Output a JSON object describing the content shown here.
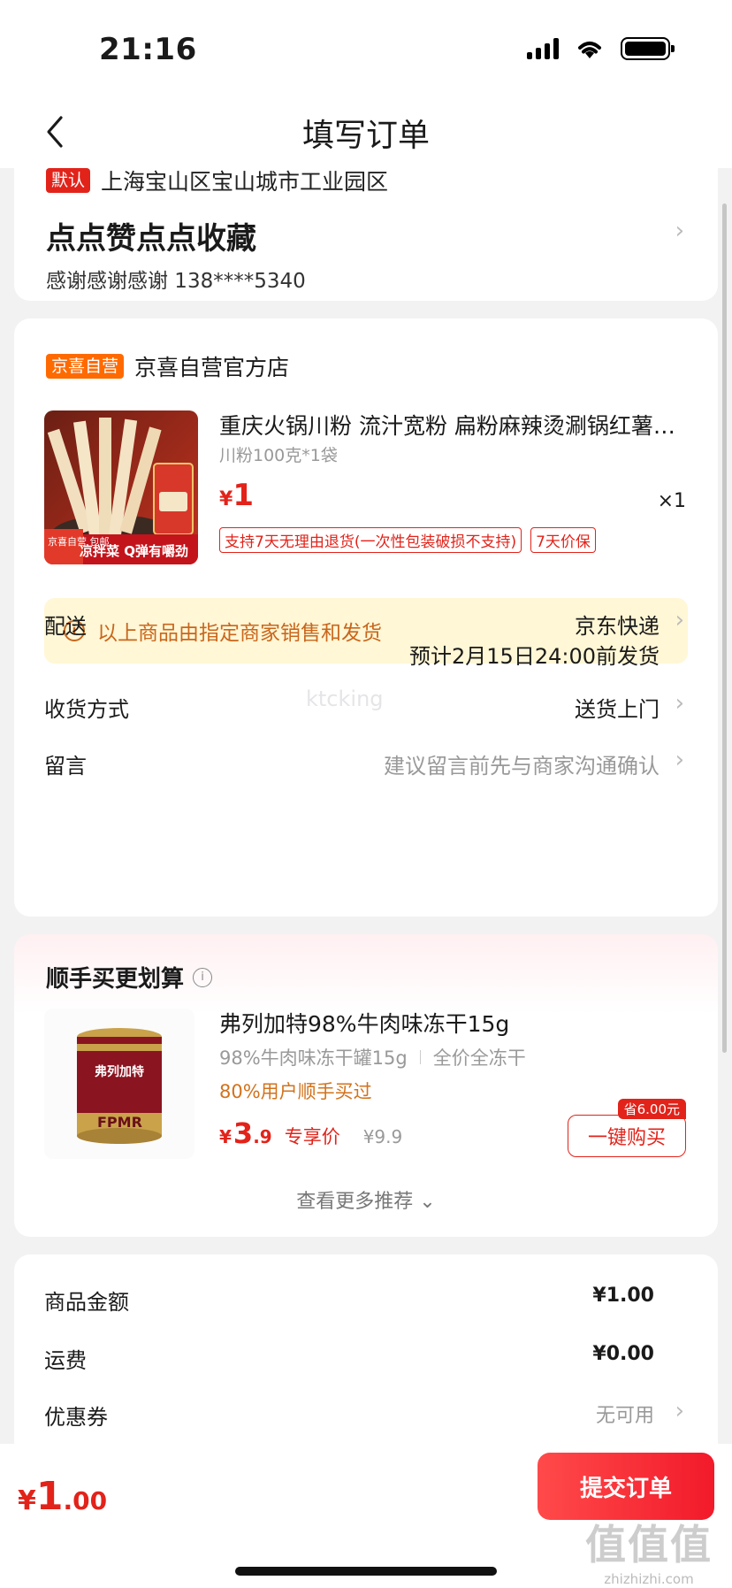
{
  "status_bar": {
    "time": "21:16"
  },
  "nav": {
    "title": "填写订单"
  },
  "address": {
    "default_tag": "默认",
    "region": "上海宝山区宝山城市工业园区",
    "detail": "点点赞点点收藏",
    "contact": "感谢感谢感谢  138****5340"
  },
  "store": {
    "tag": "京喜自营",
    "name": "京喜自营官方店",
    "product": {
      "title": "重庆火锅川粉 流汁宽粉 扁粉麻辣烫涮锅红薯粉条",
      "spec": "川粉100克*1袋",
      "price_currency": "¥",
      "price_int": "1",
      "qty": "×1",
      "badges": [
        "支持7天无理由退货(一次性包装破损不支持)",
        "7天价保"
      ],
      "image_overlay": {
        "corner": "京喜自营 包邮",
        "caption": "凉拌菜 Q弹有嚼劲"
      }
    },
    "notice": "以上商品由指定商家销售和发货",
    "delivery": {
      "label": "配送",
      "value": "京东快递",
      "eta": "预计2月15日24:00前发货"
    },
    "receive": {
      "label": "收货方式",
      "value": "送货上门"
    },
    "message": {
      "label": "留言",
      "placeholder": "建议留言前先与商家沟通确认"
    },
    "watermark": "ktcking"
  },
  "recommend": {
    "title": "顺手买更划算",
    "product": {
      "name": "弗列加特98%牛肉味冻干15g",
      "spec_1": "98%牛肉味冻干罐15g",
      "spec_2": "全价全冻干",
      "buyers": "80%用户顺手买过",
      "price_currency": "¥",
      "price_int": "3",
      "price_dec": ".9",
      "price_label": "专享价",
      "orig_price": "¥9.9",
      "save_tag": "省6.00元",
      "buy_label": "一键购买",
      "can_text": "弗列加特",
      "can_subtext": "FPMR"
    },
    "more": "查看更多推荐"
  },
  "summary": {
    "goods_label": "商品金额",
    "goods_value": "¥1.00",
    "shipping_label": "运费",
    "shipping_value": "¥0.00",
    "coupon_label": "优惠券",
    "coupon_value": "无可用"
  },
  "bottom": {
    "total_currency": "¥",
    "total_int": "1",
    "total_dec": ".00",
    "submit": "提交订单"
  },
  "corner_watermark": {
    "big": "值值值",
    "small": "zhizhizhi.com"
  },
  "colors": {
    "accent": "#e2231a",
    "store_tag": "#ff6a00",
    "notice_bg": "#fff7d6",
    "notice_text": "#c9661c"
  }
}
